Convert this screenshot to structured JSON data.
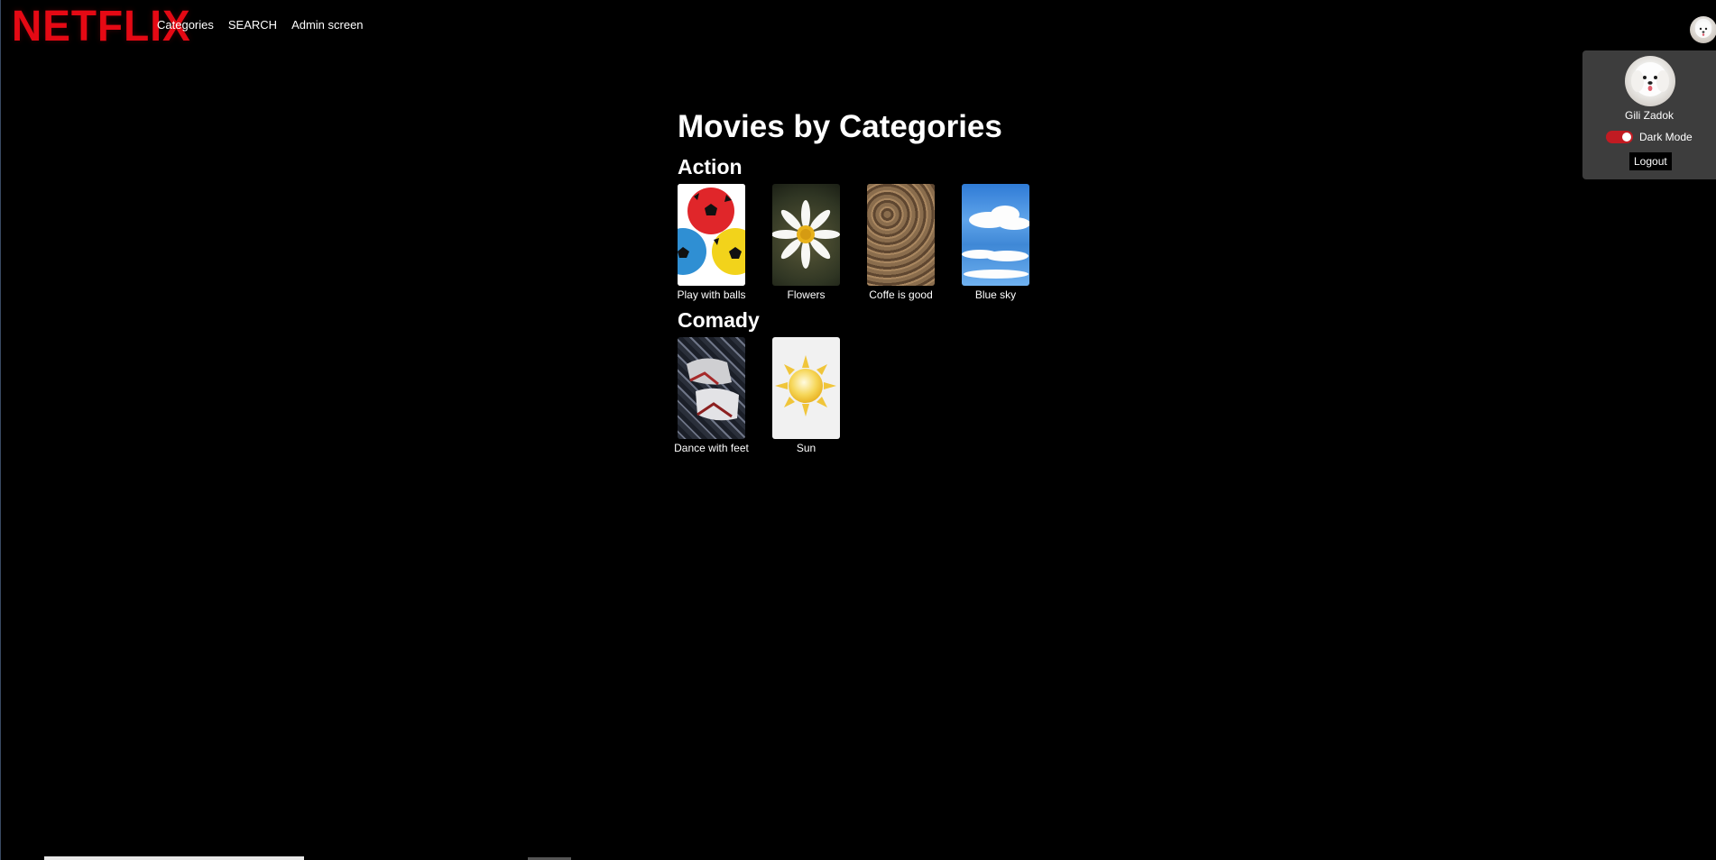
{
  "brand": {
    "logo_text": "NETFLIX",
    "logo_color": "#e50914"
  },
  "nav": {
    "items": [
      {
        "label": "Categories"
      },
      {
        "label": "SEARCH"
      },
      {
        "label": "Admin screen"
      }
    ]
  },
  "profile": {
    "name": "Gili Zadok",
    "dark_mode_label": "Dark Mode",
    "dark_mode_on": true,
    "logout_label": "Logout"
  },
  "main": {
    "title": "Movies by Categories",
    "categories": [
      {
        "name": "Action",
        "movies": [
          {
            "title": "Play with balls",
            "poster": "soccer-balls"
          },
          {
            "title": "Flowers",
            "poster": "daisy"
          },
          {
            "title": "Coffe is good",
            "poster": "coffee-beans"
          },
          {
            "title": "Blue sky",
            "poster": "sky-clouds"
          }
        ]
      },
      {
        "name": "Comady",
        "movies": [
          {
            "title": "Dance with feet",
            "poster": "sneakers"
          },
          {
            "title": "Sun",
            "poster": "sun"
          }
        ]
      }
    ]
  }
}
